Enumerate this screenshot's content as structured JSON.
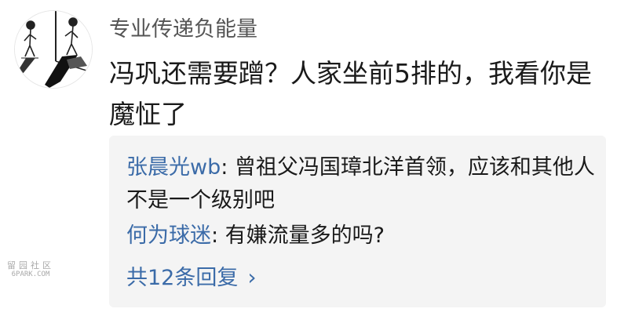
{
  "post": {
    "username": "专业传递负能量",
    "comment_text": "冯巩还需要蹭？人家坐前5排的，我看你是魔怔了"
  },
  "replies": [
    {
      "author": "张晨光wb",
      "separator": ": ",
      "text": "曾祖父冯国璋北洋首领，应该和其他人不是一个级别吧"
    },
    {
      "author": "何为球迷",
      "separator": ": ",
      "text": "有嫌流量多的吗?"
    }
  ],
  "more_replies_label": "共12条回复",
  "more_replies_icon": "chevron-right-icon",
  "watermark": {
    "line1": "留园社区",
    "line2": "6PARK.COM"
  },
  "colors": {
    "link": "#3b6ba8",
    "username": "#555555",
    "text": "#1a1a1a",
    "reply_bg": "#f4f4f4"
  }
}
